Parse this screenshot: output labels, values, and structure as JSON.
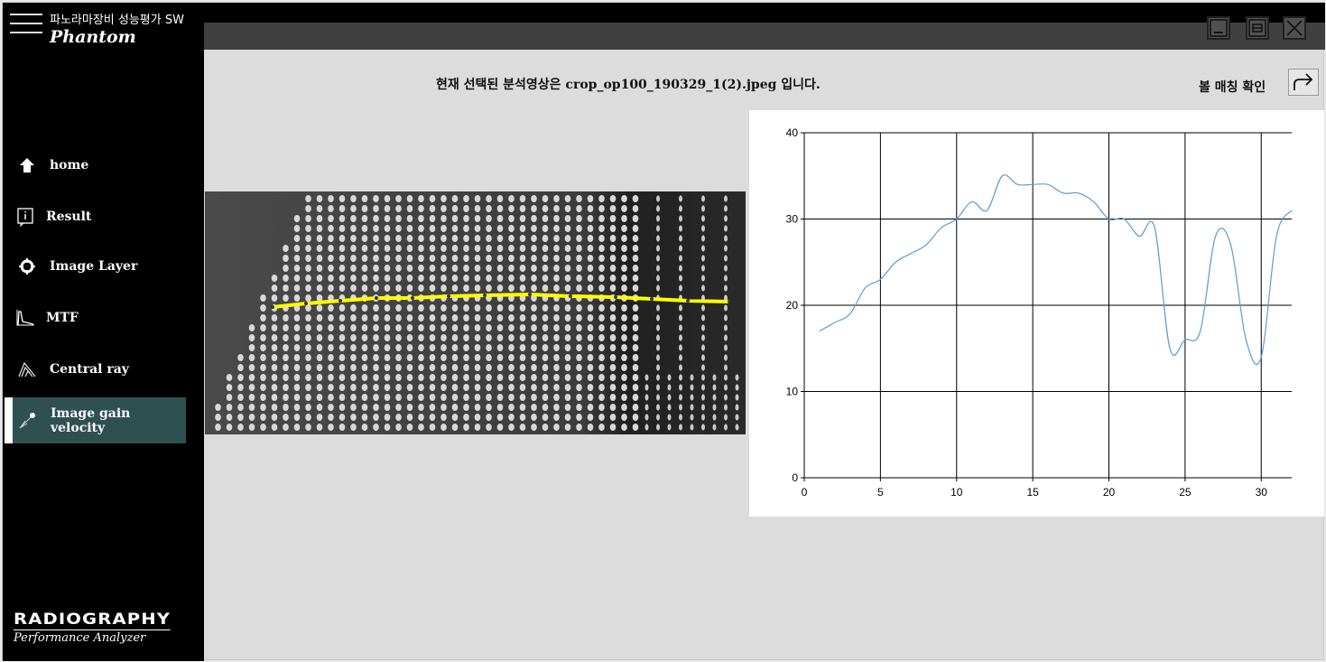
{
  "app": {
    "title": "파노라마장비 성능평가 SW",
    "logo": "Phantom",
    "brand_line1": "RADIOGRAPHY",
    "brand_line2": "Performance Analyzer"
  },
  "sidebar": {
    "items": [
      {
        "label": "home",
        "icon": "home-icon"
      },
      {
        "label": "Result",
        "icon": "info-icon"
      },
      {
        "label": "Image Layer",
        "icon": "crosshair-icon"
      },
      {
        "label": "MTF",
        "icon": "mtf-graph-icon"
      },
      {
        "label": "Central ray",
        "icon": "central-ray-icon"
      },
      {
        "label": "Image gain velocity",
        "icon": "velocity-icon",
        "active": true
      }
    ]
  },
  "main": {
    "title": "현재 선택된 분석영상은 crop_op100_190329_1(2).jpeg 입니다.",
    "match_label": "볼 매칭 확인",
    "match_icon": "redo-arrow-icon"
  },
  "colors": {
    "sidebar": "#000000",
    "active_item": "#2f5050",
    "series": "#5b9bd5",
    "overlay_line": "#ffff00"
  },
  "chart_data": {
    "type": "line",
    "title": "",
    "xlabel": "",
    "ylabel": "",
    "xlim": [
      0,
      32
    ],
    "ylim": [
      0,
      40
    ],
    "xticks": [
      0,
      5,
      10,
      15,
      20,
      25,
      30
    ],
    "yticks": [
      0,
      10,
      20,
      30,
      40
    ],
    "grid": true,
    "smooth": true,
    "x": [
      1,
      2,
      3,
      4,
      5,
      6,
      7,
      8,
      9,
      10,
      11,
      12,
      13,
      14,
      15,
      16,
      17,
      18,
      19,
      20,
      21,
      22,
      23,
      24,
      25,
      26,
      27,
      28,
      29,
      30,
      31,
      32
    ],
    "y": [
      17,
      18,
      19,
      22,
      23,
      25,
      26,
      27,
      29,
      30,
      32,
      31,
      35,
      34,
      34,
      34,
      33,
      33,
      32,
      30,
      30,
      28,
      29,
      15,
      16,
      17,
      28,
      27,
      16,
      14,
      28,
      31
    ]
  }
}
